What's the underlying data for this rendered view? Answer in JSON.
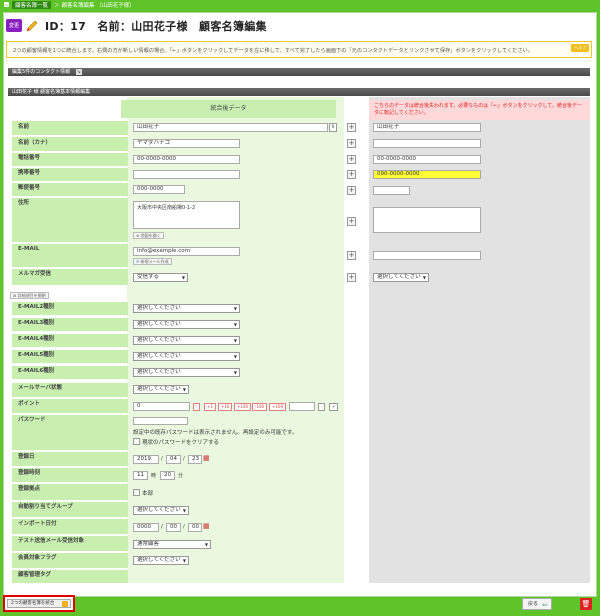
{
  "breadcrumb": {
    "items": [
      "顧客名簿一覧",
      "顧客名簿編集 （山田花子様）"
    ]
  },
  "header": {
    "badge": "変更",
    "title": "ID：17　名前：山田花子様　顧客名簿編集"
  },
  "help": {
    "text": "2つの顧客情報を1つに統合します。右側の方が新しい情報の場合、「←」ボタンをクリックしてデータを左に移して、すべて完了したら画面下の「元のコンタクトデータとリンクさせて保存」ボタンをクリックしてください。",
    "tag": "ヘルプ"
  },
  "sections": {
    "contact": "編集5件のコンタクト情報",
    "main": "山田花子 様 顧客名簿基本情報編集"
  },
  "columns": {
    "main_header": "統合後データ",
    "right_notice": "こちらのデータは統合後失われます。必要なものは「←」ボタンをクリックして、統合後データに転記してください。"
  },
  "rows": {
    "name": {
      "label": "名前",
      "value": "山田花子",
      "right": "山田花子"
    },
    "kana": {
      "label": "名前（カナ）",
      "value": "ヤマダハナコ"
    },
    "phone": {
      "label": "電話番号",
      "value": "00-0000-0000",
      "right": "00-0000-0000"
    },
    "mobile": {
      "label": "携帯番号",
      "value": "",
      "right": "090-0000-0000"
    },
    "zip": {
      "label": "郵便番号",
      "value": "000-0000"
    },
    "address": {
      "label": "住所",
      "value": "大阪市中央区南船場0-1-2",
      "map_btn": "地図を開く"
    },
    "email": {
      "label": "E-MAIL",
      "value": "info@example.com",
      "new_mail_btn": "新規メール作成"
    },
    "magazine": {
      "label": "メルマガ受信",
      "value": "受信する",
      "right": "選択してください"
    },
    "detail_btn": "詳細項目を開閉",
    "email2": {
      "label": "E-MAIL2種別",
      "value": "選択してください"
    },
    "email3": {
      "label": "E-MAIL3種別",
      "value": "選択してください"
    },
    "email4": {
      "label": "E-MAIL4種別",
      "value": "選択してください"
    },
    "email5": {
      "label": "E-MAIL5種別",
      "value": "選択してください"
    },
    "email6": {
      "label": "E-MAIL6種別",
      "value": "選択してください"
    },
    "mailserver": {
      "label": "メールサーバ状態",
      "value": "選択してください"
    },
    "point": {
      "label": "ポイント",
      "value": "0",
      "buttons": [
        "-",
        "+1",
        "+10",
        "+100",
        "-100",
        "+100"
      ],
      "minus": "-",
      "plus": "+"
    },
    "password": {
      "label": "パスワード",
      "note": "設定中の既存パスワードは表示されません。再設定のみ可能です。",
      "clear": "現状のパスワードをクリアする"
    },
    "regdate": {
      "label": "登録日",
      "y": "2019",
      "m": "04",
      "d": "23"
    },
    "regtime": {
      "label": "登録時刻",
      "h": "11",
      "hu": "時",
      "mi": "20",
      "mu": "分"
    },
    "regbase": {
      "label": "登録拠点",
      "value": "本部"
    },
    "autogroup": {
      "label": "自動割り当てグループ",
      "value": "選択してください"
    },
    "importdate": {
      "label": "インポート日付",
      "y": "0000",
      "m": "00",
      "d": "00"
    },
    "testmail": {
      "label": "テスト送信メール受信対象",
      "value": "通常顧客"
    },
    "memberflag": {
      "label": "会員対象フラグ",
      "value": "選択してください"
    },
    "tag": {
      "label": "顧客管理タグ"
    }
  },
  "footer": {
    "merge_btn": "2つの顧客名簿を統合",
    "back_btn": "戻る"
  }
}
